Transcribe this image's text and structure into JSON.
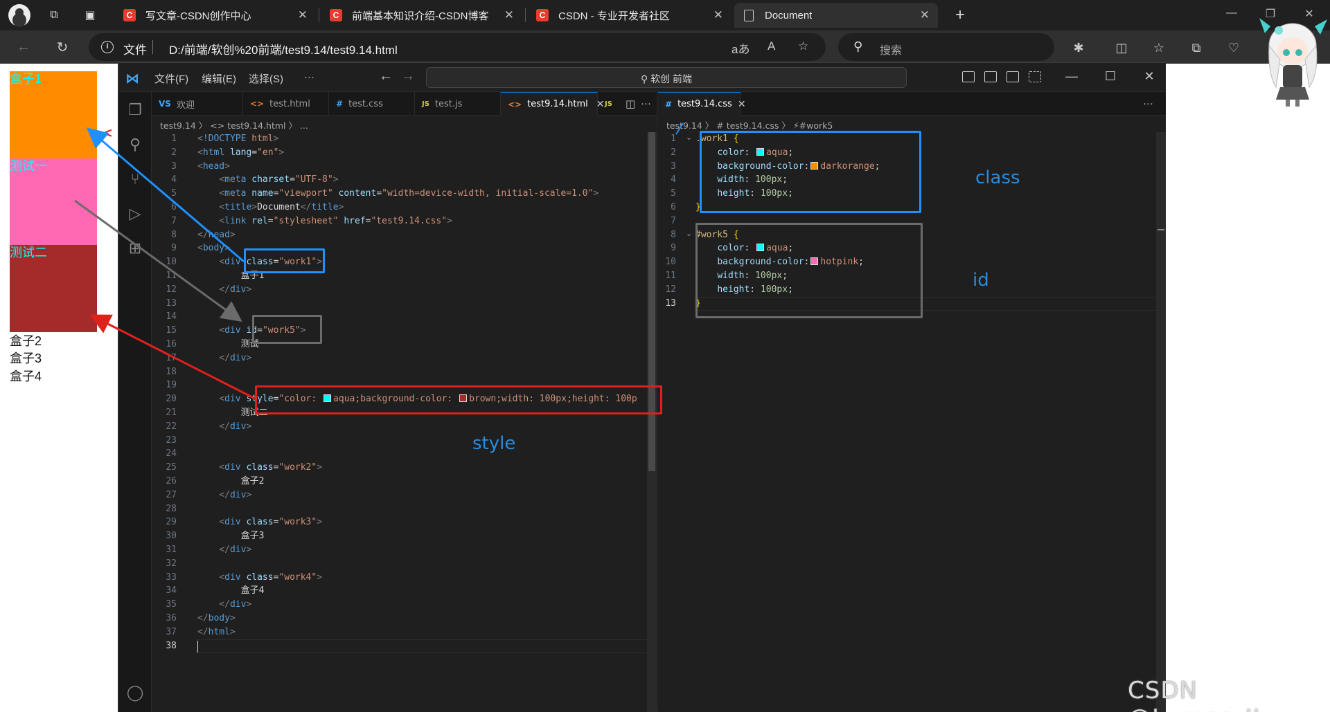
{
  "browser": {
    "tabs": [
      {
        "title": "写文章-CSDN创作中心",
        "favicon": "C"
      },
      {
        "title": "前端基本知识介绍-CSDN博客",
        "favicon": "C"
      },
      {
        "title": "CSDN - 专业开发者社区",
        "favicon": "C"
      },
      {
        "title": "Document",
        "favicon": "doc"
      }
    ],
    "address": {
      "label": "文件",
      "url": "D:/前端/软创%20前端/test9.14/test9.14.html"
    },
    "search_placeholder": "搜索"
  },
  "rendered_page": {
    "boxes": [
      {
        "text": "盒子1",
        "bg": "#ff8c00"
      },
      {
        "text": "测试一",
        "bg": "#ff69b4"
      },
      {
        "text": "测试二",
        "bg": "#a52a2a"
      }
    ],
    "plain_items": [
      "盒子2",
      "盒子3",
      "盒子4"
    ]
  },
  "vscode": {
    "menus": [
      "文件(F)",
      "编辑(E)",
      "选择(S)",
      "···"
    ],
    "command_center": "软创 前端",
    "left_tabs": [
      {
        "icon": "VS",
        "label": "欢迎",
        "active": false
      },
      {
        "icon": "<>",
        "label": "test.html",
        "active": false
      },
      {
        "icon": "#",
        "label": "test.css",
        "active": false
      },
      {
        "icon": "JS",
        "label": "test.js",
        "active": false
      },
      {
        "icon": "<>",
        "label": "test9.14.html",
        "active": true
      },
      {
        "icon": "JS",
        "label": "",
        "active": false
      }
    ],
    "left_breadcrumb": "test9.14 〉 <> test9.14.html 〉 ...",
    "right_tab": "test9.14.css",
    "right_breadcrumb": "test9.14 〉 # test9.14.css 〉 ⚡#work5",
    "html_lines": [
      "<!DOCTYPE html>",
      "<html lang=\"en\">",
      "<head>",
      "    <meta charset=\"UTF-8\">",
      "    <meta name=\"viewport\" content=\"width=device-width, initial-scale=1.0\">",
      "    <title>Document</title>",
      "    <link rel=\"stylesheet\" href=\"test9.14.css\">",
      "</head>",
      "<body>",
      "    <div class=\"work1\">",
      "        盒子1",
      "    </div>",
      "",
      "",
      "    <div id=\"work5\">",
      "        测试",
      "    </div>",
      "",
      "",
      "    <div style=\"color: aqua;background-color: brown;width: 100px;height: 100p",
      "        测试二",
      "    </div>",
      "",
      "",
      "    <div class=\"work2\">",
      "        盒子2",
      "    </div>",
      "",
      "    <div class=\"work3\">",
      "        盒子3",
      "    </div>",
      "",
      "    <div class=\"work4\">",
      "        盒子4",
      "    </div>",
      "</body>",
      "</html>",
      ""
    ],
    "css_lines": [
      ".work1 {",
      "    color: aqua;",
      "    background-color: darkorange;",
      "    width: 100px;",
      "    height: 100px;",
      "}",
      "",
      "#work5 {",
      "    color: aqua;",
      "    background-color: hotpink;",
      "    width: 100px;",
      "    height: 100px;",
      "}"
    ]
  },
  "annotations": {
    "class_label": "class",
    "id_label": "id",
    "style_label": "style"
  },
  "watermark": "CSDN @Lumos_JJ",
  "colors": {
    "accent_blue": "#1e90ff",
    "accent_red": "#e0201b",
    "accent_gray": "#6b6b6b"
  }
}
